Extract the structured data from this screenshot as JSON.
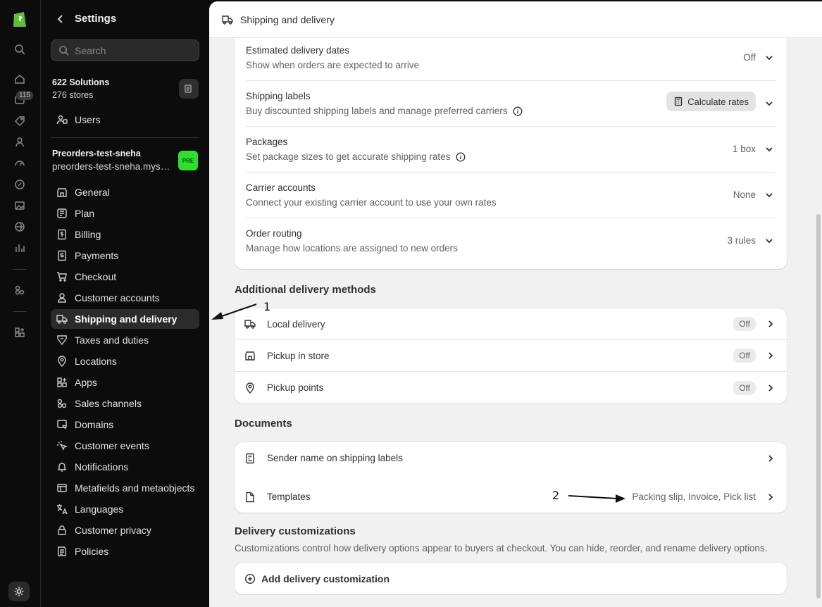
{
  "rail": {
    "badge": "115",
    "icons": [
      "home-icon",
      "orders-icon",
      "products-icon",
      "customers-icon",
      "marketing-icon",
      "discounts-icon",
      "content-icon",
      "online-store-icon",
      "analytics-icon",
      "apps-icon",
      "add-apps-icon",
      "settings-icon"
    ]
  },
  "sidebar": {
    "title": "Settings",
    "search_placeholder": "Search",
    "org": {
      "name": "622 Solutions",
      "sub": "276 stores"
    },
    "users_label": "Users",
    "store": {
      "name": "Preorders-test-sneha",
      "domain": "preorders-test-sneha.myshopify.com",
      "badge": "PRE"
    },
    "items": [
      {
        "label": "General"
      },
      {
        "label": "Plan"
      },
      {
        "label": "Billing"
      },
      {
        "label": "Payments"
      },
      {
        "label": "Checkout"
      },
      {
        "label": "Customer accounts"
      },
      {
        "label": "Shipping and delivery"
      },
      {
        "label": "Taxes and duties"
      },
      {
        "label": "Locations"
      },
      {
        "label": "Apps"
      },
      {
        "label": "Sales channels"
      },
      {
        "label": "Domains"
      },
      {
        "label": "Customer events"
      },
      {
        "label": "Notifications"
      },
      {
        "label": "Metafields and metaobjects"
      },
      {
        "label": "Languages"
      },
      {
        "label": "Customer privacy"
      },
      {
        "label": "Policies"
      }
    ]
  },
  "header": {
    "title": "Shipping and delivery"
  },
  "settings_rows": [
    {
      "title": "Estimated delivery dates",
      "desc": "Show when orders are expected to arrive",
      "value": "Off"
    },
    {
      "title": "Shipping labels",
      "desc": "Buy discounted shipping labels and manage preferred carriers",
      "button": "Calculate rates"
    },
    {
      "title": "Packages",
      "desc": "Set package sizes to get accurate shipping rates",
      "value": "1 box"
    },
    {
      "title": "Carrier accounts",
      "desc": "Connect your existing carrier account to use your own rates",
      "value": "None"
    },
    {
      "title": "Order routing",
      "desc": "Manage how locations are assigned to new orders",
      "value": "3 rules"
    }
  ],
  "additional": {
    "title": "Additional delivery methods",
    "rows": [
      {
        "label": "Local delivery",
        "badge": "Off"
      },
      {
        "label": "Pickup in store",
        "badge": "Off"
      },
      {
        "label": "Pickup points",
        "badge": "Off"
      }
    ]
  },
  "documents": {
    "title": "Documents",
    "rows": [
      {
        "label": "Sender name on shipping labels"
      },
      {
        "label": "Templates",
        "value": "Packing slip, Invoice, Pick list"
      }
    ]
  },
  "customizations": {
    "title": "Delivery customizations",
    "desc": "Customizations control how delivery options appear to buyers at checkout. You can hide, reorder, and rename delivery options.",
    "add_label": "Add delivery customization"
  },
  "annotations": {
    "one": "1",
    "two": "2"
  }
}
